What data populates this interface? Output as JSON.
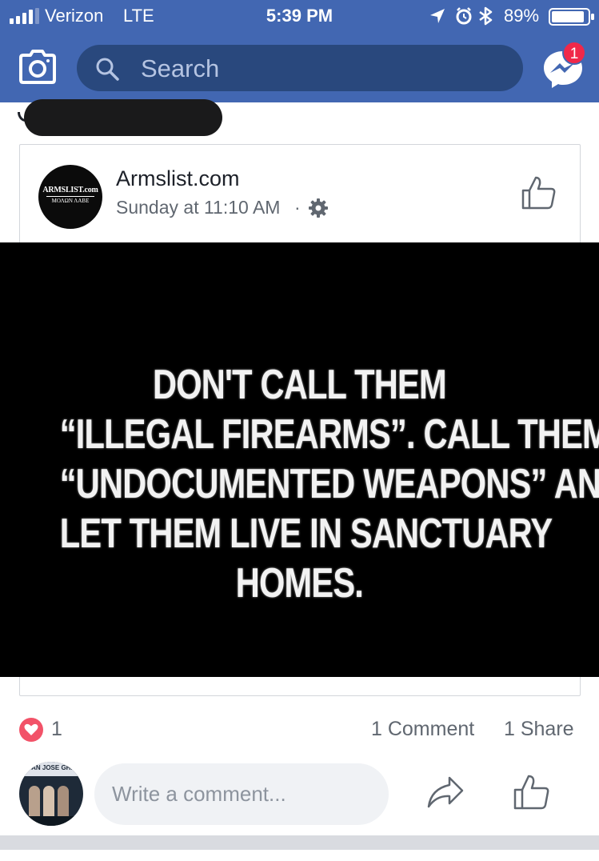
{
  "status_bar": {
    "carrier": "Verizon",
    "network": "LTE",
    "time": "5:39 PM",
    "battery_percent": "89%",
    "icons": [
      "signal-icon",
      "location-arrow-icon",
      "alarm-icon",
      "bluetooth-icon",
      "battery-icon"
    ]
  },
  "nav": {
    "search_placeholder": "Search",
    "camera_icon": "camera-icon",
    "messenger_icon": "messenger-icon",
    "messenger_badge": "1"
  },
  "post": {
    "page_avatar": {
      "logo_text": "ARMSLIST.com",
      "logo_tagline": "ΜΟΛΩΝ ΛΑΒΕ"
    },
    "page_name": "Armslist.com",
    "timestamp": "Sunday at 11:10 AM",
    "separator": "·",
    "meme_lines": [
      "DON'T CALL THEM",
      "“ILLEGAL FIREARMS”.  CALL THEM",
      "“UNDOCUMENTED WEAPONS” AND",
      "LET THEM LIVE IN SANCTUARY",
      "HOMES."
    ]
  },
  "reactions": {
    "count": "1",
    "comments": "1 Comment",
    "shares": "1 Share"
  },
  "composer": {
    "placeholder": "Write a comment...",
    "avatar_title": "SAN JOSE GHA"
  },
  "colors": {
    "header_blue": "#4267b2",
    "search_bg": "#29487d",
    "badge_red": "#f02849",
    "love_red": "#f25268",
    "meta_gray": "#606770"
  }
}
